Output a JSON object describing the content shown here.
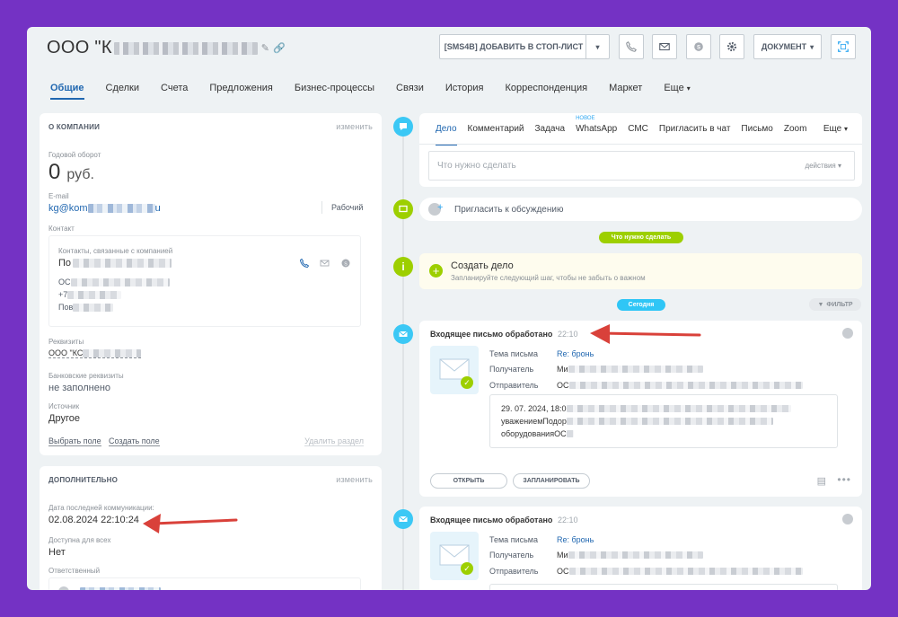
{
  "header": {
    "title": "ООО \"К",
    "stoplist_button": "[SMS4B] ДОБАВИТЬ В СТОП-ЛИСТ",
    "document_button": "ДОКУМЕНТ"
  },
  "tabs": [
    "Общие",
    "Сделки",
    "Счета",
    "Предложения",
    "Бизнес-процессы",
    "Связи",
    "История",
    "Корреспонденция",
    "Маркет",
    "Еще"
  ],
  "about": {
    "title": "О КОМПАНИИ",
    "edit": "изменить",
    "turnover_label": "Годовой оборот",
    "turnover_value": "0",
    "turnover_currency": "руб.",
    "email_label": "E-mail",
    "email_start": "kg@kom",
    "email_end": "u",
    "email_type": "Рабочий",
    "contact_label": "Контакт",
    "contacts_caption": "Контакты, связанные с компанией",
    "contact_name": "По",
    "contact_line2": "ОС",
    "contact_phone": "+7",
    "contact_line4": "Пов",
    "requisites_label": "Реквизиты",
    "requisites_value": "ООО \"КС",
    "bank_label": "Банковские реквизиты",
    "bank_value": "не заполнено",
    "source_label": "Источник",
    "source_value": "Другое",
    "choose_field": "Выбрать поле",
    "create_field": "Создать поле",
    "delete_section": "Удалить раздел"
  },
  "additional": {
    "title": "ДОПОЛНИТЕЛЬНО",
    "edit": "изменить",
    "last_comm_label": "Дата последней коммуникации:",
    "last_comm_value": "02.08.2024 22:10:24",
    "available_label": "Доступна для всех",
    "available_value": "Нет",
    "responsible_label": "Ответственный"
  },
  "editor": {
    "tabs": [
      "Дело",
      "Комментарий",
      "Задача",
      "WhatsApp",
      "СМС",
      "Пригласить в чат",
      "Письмо",
      "Zoom",
      "Еще"
    ],
    "new_badge": "НОВОЕ",
    "placeholder": "Что нужно сделать",
    "actions": "действия"
  },
  "invite": "Пригласить к обсуждению",
  "todo_pill": "Что нужно сделать",
  "create_task": {
    "title": "Создать дело",
    "subtitle": "Запланируйте следующий шаг, чтобы не забыть о важном"
  },
  "today_pill": "Сегодня",
  "filter": "ФИЛЬТР",
  "mail1": {
    "title": "Входящее письмо обработано",
    "time": "22:10",
    "subject_label": "Тема письма",
    "subject_value": "Re: бронь",
    "recipient_label": "Получатель",
    "recipient_value": "Ми",
    "sender_label": "Отправитель",
    "sender_value": "ОС",
    "quote_line1": "29. 07. 2024, 18:0",
    "quote_line2": "уважениемПодор",
    "quote_line3": "оборудованияОС",
    "open_button": "ОТКРЫТЬ",
    "plan_button": "ЗАПЛАНИРОВАТЬ"
  },
  "mail2": {
    "title": "Входящее письмо обработано",
    "time": "22:10",
    "subject_label": "Тема письма",
    "subject_value": "Re: бронь",
    "recipient_label": "Получатель",
    "recipient_value": "Ми",
    "sender_label": "Отправитель",
    "sender_value": "ОС"
  },
  "colors": {
    "background": "#7432c4",
    "accent": "#2067b0",
    "timeline_blue": "#3bc8f5",
    "timeline_green": "#9dcf00",
    "arrow": "#d9413a"
  }
}
